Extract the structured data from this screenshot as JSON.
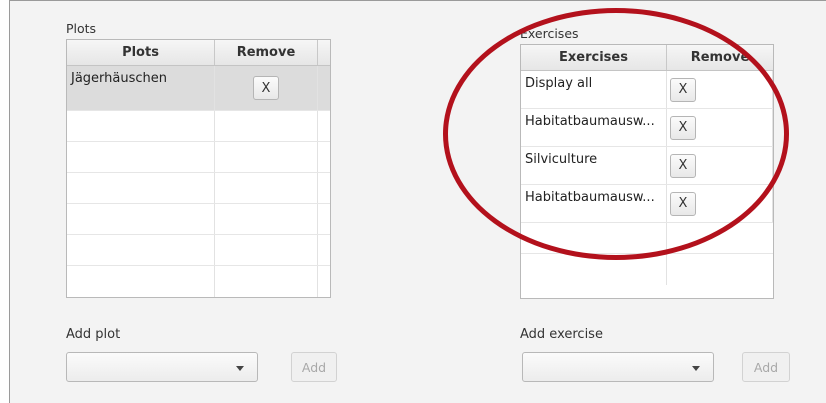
{
  "plots": {
    "section_label": "Plots",
    "columns": [
      "Plots",
      "Remove"
    ],
    "rows": [
      {
        "name": "Jägerhäuschen",
        "remove_label": "X"
      }
    ],
    "add_label": "Add plot",
    "add_button": "Add"
  },
  "exercises": {
    "section_label": "Exercises",
    "columns": [
      "Exercises",
      "Remove"
    ],
    "rows": [
      {
        "name": "Display all",
        "remove_label": "X"
      },
      {
        "name": "Habitatbaumausw...",
        "remove_label": "X"
      },
      {
        "name": "Silviculture",
        "remove_label": "X"
      },
      {
        "name": "Habitatbaumausw...",
        "remove_label": "X"
      }
    ],
    "add_label": "Add exercise",
    "add_button": "Add"
  },
  "colors": {
    "annotation_circle": "#b3111c",
    "panel_background": "#f3f3f3"
  }
}
